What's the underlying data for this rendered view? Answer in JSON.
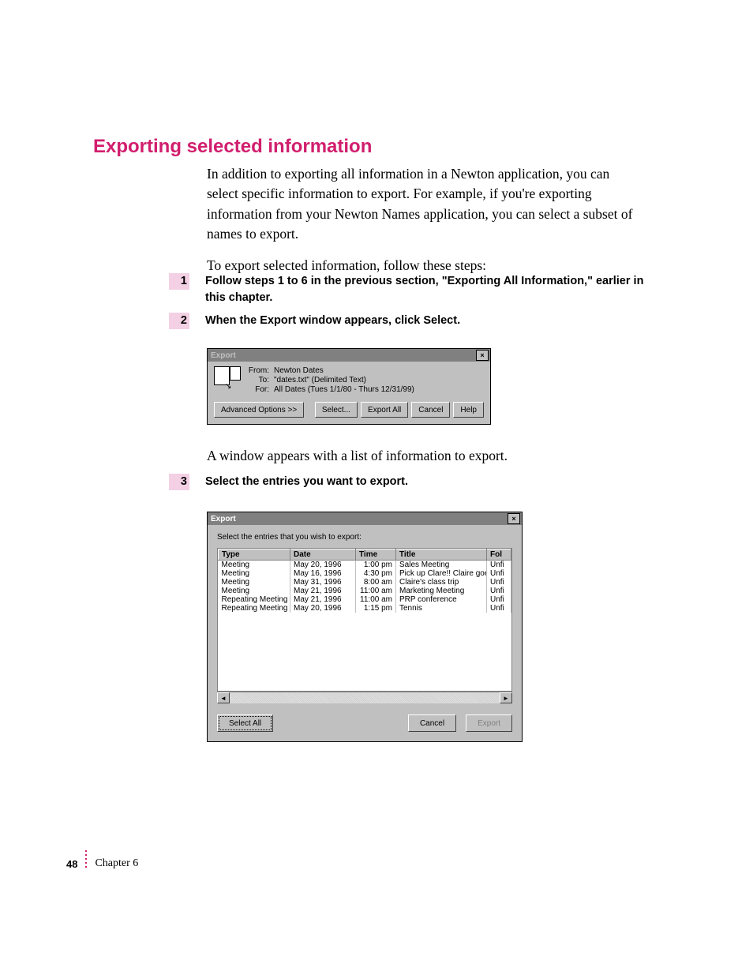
{
  "heading": "Exporting selected information",
  "para1": "In addition to exporting all information in a Newton application, you can select specific information to export. For example, if you're exporting information from your Newton Names application, you can select a subset of names to export.",
  "para2": "To export selected information, follow these steps:",
  "steps": {
    "s1": {
      "num": "1",
      "text": "Follow steps 1 to 6 in the previous section, \"Exporting All Information,\" earlier in this chapter."
    },
    "s2": {
      "num": "2",
      "text": "When the Export window appears, click Select."
    },
    "s3": {
      "num": "3",
      "text": "Select the entries you want to export."
    }
  },
  "fig1": {
    "title": "Export",
    "from_lbl": "From:",
    "from_val": "Newton Dates",
    "to_lbl": "To:",
    "to_val": "\"dates.txt\" (Delimited Text)",
    "for_lbl": "For:",
    "for_val": "All Dates (Tues 1/1/80 - Thurs 12/31/99)",
    "adv": "Advanced Options >>",
    "select": "Select...",
    "exportall": "Export All",
    "cancel": "Cancel",
    "help": "Help"
  },
  "mid": "A window appears with a list of information to export.",
  "fig2": {
    "title": "Export",
    "instruct": "Select the entries that you wish to export:",
    "headers": {
      "type": "Type",
      "date": "Date",
      "time": "Time",
      "title": "Title",
      "fol": "Fol"
    },
    "rows": [
      {
        "type": "Meeting",
        "date": "May 20, 1996",
        "time": "1:00 pm",
        "title": "Sales Meeting",
        "fol": "Unfi"
      },
      {
        "type": "Meeting",
        "date": "May 16, 1996",
        "time": "4:30 pm",
        "title": "Pick up Clare!! Claire goes to ballet",
        "fol": "Unfi"
      },
      {
        "type": "Meeting",
        "date": "May 31, 1996",
        "time": "8:00 am",
        "title": "Claire's class trip",
        "fol": "Unfi"
      },
      {
        "type": "Meeting",
        "date": "May 21, 1996",
        "time": "11:00 am",
        "title": "Marketing Meeting",
        "fol": "Unfi"
      },
      {
        "type": "Repeating Meeting",
        "date": "May 21, 1996",
        "time": "11:00 am",
        "title": "PRP conference",
        "fol": "Unfi"
      },
      {
        "type": "Repeating Meeting",
        "date": "May 20, 1996",
        "time": "1:15 pm",
        "title": "Tennis",
        "fol": "Unfi"
      }
    ],
    "selectall": "Select All",
    "cancel": "Cancel",
    "export": "Export"
  },
  "footer": {
    "page": "48",
    "chapter": "Chapter 6"
  }
}
